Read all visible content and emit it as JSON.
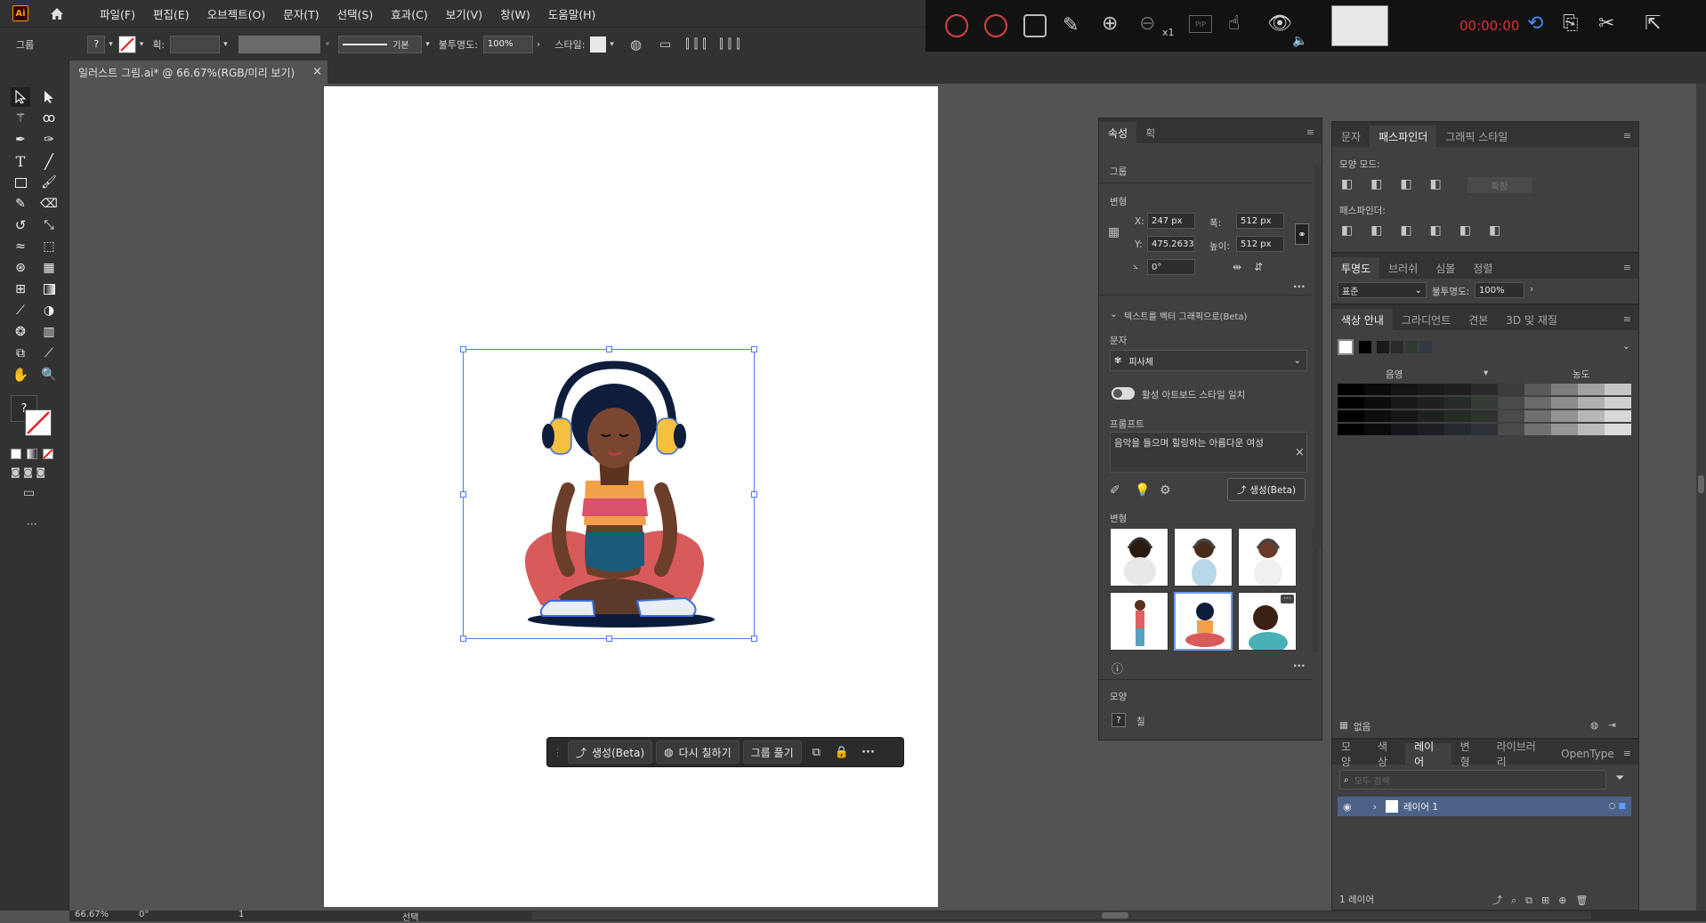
{
  "app": {
    "logo": "Ai"
  },
  "menu": [
    "파일(F)",
    "편집(E)",
    "오브젝트(O)",
    "문자(T)",
    "선택(S)",
    "효과(C)",
    "보기(V)",
    "창(W)",
    "도움말(H)"
  ],
  "control_bar": {
    "selection_label": "그룹",
    "stroke_label": "획:",
    "stroke_style": "기본",
    "opacity_label": "불투명도:",
    "opacity_value": "100%",
    "style_label": "스타일:"
  },
  "recorder": {
    "time": "00:00:00",
    "zoom_label": "x1",
    "pip_label": "PIP"
  },
  "document_tab": {
    "title": "일러스트 그림.ai* @ 66.67%(RGB/미리 보기)",
    "close": "×"
  },
  "context_bar": {
    "generate": "생성(Beta)",
    "recolor": "다시 칠하기",
    "ungroup": "그룹 풀기",
    "more": "···"
  },
  "properties_panel": {
    "tabs": [
      "속성",
      "획"
    ],
    "section_group": "그룹",
    "section_transform": "변형",
    "x_label": "X:",
    "x_value": "247 px",
    "y_label": "Y:",
    "y_value": "475.2633",
    "w_label": "폭:",
    "w_value": "512 px",
    "h_label": "높이:",
    "h_value": "512 px",
    "angle_value": "0°",
    "text_to_vector_title": "텍스트를 벡터 그래픽으로(Beta)",
    "type_label": "문자",
    "type_value": "피사체",
    "match_style_label": "활성 아트보드 스타일 일치",
    "prompt_label": "프롬프트",
    "prompt_value": "음악을 들으며 힐링하는 아름다운  여성",
    "generate_button": "생성(Beta)",
    "variations_label": "변형",
    "appearance_label": "모양",
    "fill_label": "칠",
    "more": "···"
  },
  "pathfinder_panel": {
    "tabs": [
      "문자",
      "패스파인더",
      "그래픽 스타일"
    ],
    "shape_modes_label": "모양 모드:",
    "expand_button": "확장",
    "pathfinders_label": "패스파인더:"
  },
  "transparency_panel": {
    "tabs": [
      "투명도",
      "브러쉬",
      "심볼",
      "정렬"
    ],
    "blend_mode": "표준",
    "opacity_label": "불투명도:",
    "opacity_value": "100%"
  },
  "color_guide_panel": {
    "tabs": [
      "색상 안내",
      "그라디언트",
      "견본",
      "3D 및 재질"
    ],
    "shade_label": "음영",
    "tint_label": "농도",
    "none_label": "없음",
    "grid_rows": [
      [
        "#000000",
        "#0a0a0a",
        "#141414",
        "#1a1a18",
        "#1f201d",
        "#2a2a2a",
        "#3b3b3b",
        "#5a5a5a",
        "#7d7d7d",
        "#a2a2a2",
        "#c6c6c6"
      ],
      [
        "#000000",
        "#0c0c0c",
        "#181818",
        "#202020",
        "#272b27",
        "#343a34",
        "#4a4a4a",
        "#6a6a6a",
        "#8d8d8d",
        "#b0b0b0",
        "#d0d0d0"
      ],
      [
        "#000000",
        "#0c0d0c",
        "#141614",
        "#1e221e",
        "#252b25",
        "#2e332e",
        "#4a4a4a",
        "#6f6f6f",
        "#939393",
        "#b8b8b8",
        "#d8d8d8"
      ],
      [
        "#000000",
        "#0b0b0d",
        "#15161a",
        "#1d1e24",
        "#26282f",
        "#2f3139",
        "#4b4b4b",
        "#717171",
        "#969696",
        "#bcbcbc",
        "#dcdcdc"
      ]
    ]
  },
  "layers_panel": {
    "tabs": [
      "모양",
      "색상",
      "레이어",
      "변형",
      "라이브러리",
      "OpenType"
    ],
    "search_placeholder": "모두 검색",
    "layer_name": "레이어 1",
    "footer_count": "1 레이어"
  },
  "statusbar": {
    "zoom": "66.67%",
    "rotation": "0°",
    "artboard": "1",
    "mode": "선택"
  }
}
